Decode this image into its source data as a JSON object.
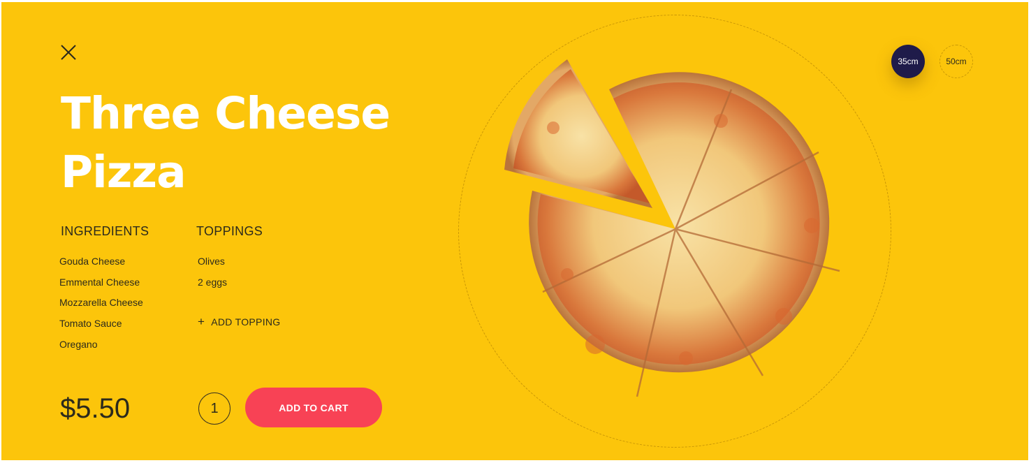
{
  "product": {
    "title": "Three Cheese Pizza",
    "price": "$5.50"
  },
  "ingredients": {
    "heading": "INGREDIENTS",
    "items": [
      "Gouda Cheese",
      "Emmental Cheese",
      "Mozzarella Cheese",
      "Tomato Sauce",
      "Oregano"
    ]
  },
  "toppings": {
    "heading": "TOPPINGS",
    "items": [
      "Olives",
      "2 eggs"
    ],
    "add_label": "ADD TOPPING",
    "add_icon": "+"
  },
  "cart": {
    "quantity": "1",
    "button_label": "ADD TO CART"
  },
  "sizes": {
    "selected": "35cm",
    "other": "50cm"
  },
  "colors": {
    "background": "#fcc50b",
    "accent": "#f84255",
    "selected_size": "#1f1b4a",
    "title": "#ffffff"
  },
  "icons": {
    "close": "close-icon",
    "add": "plus-icon"
  }
}
